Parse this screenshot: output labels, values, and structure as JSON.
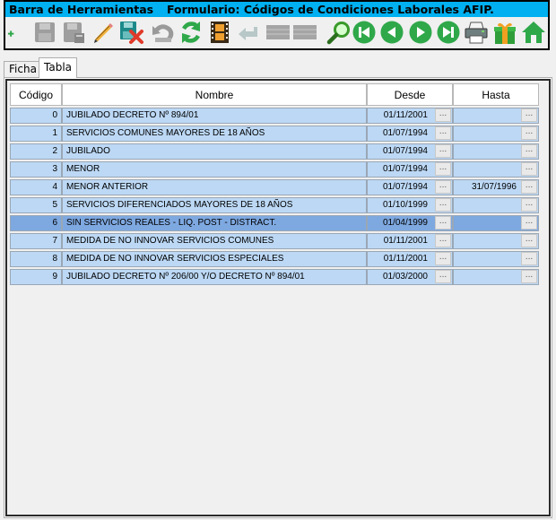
{
  "toolbar": {
    "title_left": "Barra de Herramientas",
    "title_form": "Formulario: Códigos de Condiciones Laborales AFIP.",
    "icons": [
      {
        "name": "add-icon"
      },
      {
        "name": "save-icon"
      },
      {
        "name": "save-as-icon"
      },
      {
        "name": "edit-pencil-icon"
      },
      {
        "name": "delete-icon"
      },
      {
        "name": "undo-icon"
      },
      {
        "name": "refresh-icon"
      },
      {
        "name": "film-icon"
      },
      {
        "name": "back-arrow-icon"
      },
      {
        "name": "grid-icon"
      },
      {
        "name": "grid-alt-icon"
      },
      {
        "name": "search-icon"
      },
      {
        "name": "first-record-icon"
      },
      {
        "name": "previous-record-icon"
      },
      {
        "name": "next-record-icon"
      },
      {
        "name": "last-record-icon"
      },
      {
        "name": "printer-icon"
      },
      {
        "name": "gift-icon"
      },
      {
        "name": "home-icon"
      }
    ]
  },
  "tabs": [
    {
      "label": "Ficha",
      "active": false
    },
    {
      "label": "Tabla",
      "active": true
    }
  ],
  "table": {
    "headers": {
      "code": "Código",
      "name": "Nombre",
      "from": "Desde",
      "to": "Hasta"
    },
    "button_label": "...",
    "rows": [
      {
        "code": "0",
        "name": "JUBILADO DECRETO Nº 894/01",
        "from": "01/11/2001",
        "to": "",
        "selected": false
      },
      {
        "code": "1",
        "name": "SERVICIOS COMUNES MAYORES DE 18 AÑOS",
        "from": "01/07/1994",
        "to": "",
        "selected": false
      },
      {
        "code": "2",
        "name": "JUBILADO",
        "from": "01/07/1994",
        "to": "",
        "selected": false
      },
      {
        "code": "3",
        "name": "MENOR",
        "from": "01/07/1994",
        "to": "",
        "selected": false
      },
      {
        "code": "4",
        "name": "MENOR ANTERIOR",
        "from": "01/07/1994",
        "to": "31/07/1996",
        "selected": false
      },
      {
        "code": "5",
        "name": "SERVICIOS DIFERENCIADOS MAYORES DE 18 AÑOS",
        "from": "01/10/1999",
        "to": "",
        "selected": false
      },
      {
        "code": "6",
        "name": "SIN SERVICIOS REALES - LIQ. POST - DISTRACT.",
        "from": "01/04/1999",
        "to": "",
        "selected": true
      },
      {
        "code": "7",
        "name": "MEDIDA DE NO INNOVAR SERVICIOS COMUNES",
        "from": "01/11/2001",
        "to": "",
        "selected": false
      },
      {
        "code": "8",
        "name": "MEDIDA DE NO INNOVAR SERVICIOS ESPECIALES",
        "from": "01/11/2001",
        "to": "",
        "selected": false
      },
      {
        "code": "9",
        "name": "JUBILADO DECRETO Nº 206/00 Y/O DECRETO Nº 894/01",
        "from": "01/03/2000",
        "to": "",
        "selected": false
      }
    ]
  },
  "colors": {
    "title_bar": "#00b0f0",
    "row_bg": "#bcd8f5",
    "row_selected_bg": "#7ea8e0",
    "nav_green": "#2fa84a"
  }
}
